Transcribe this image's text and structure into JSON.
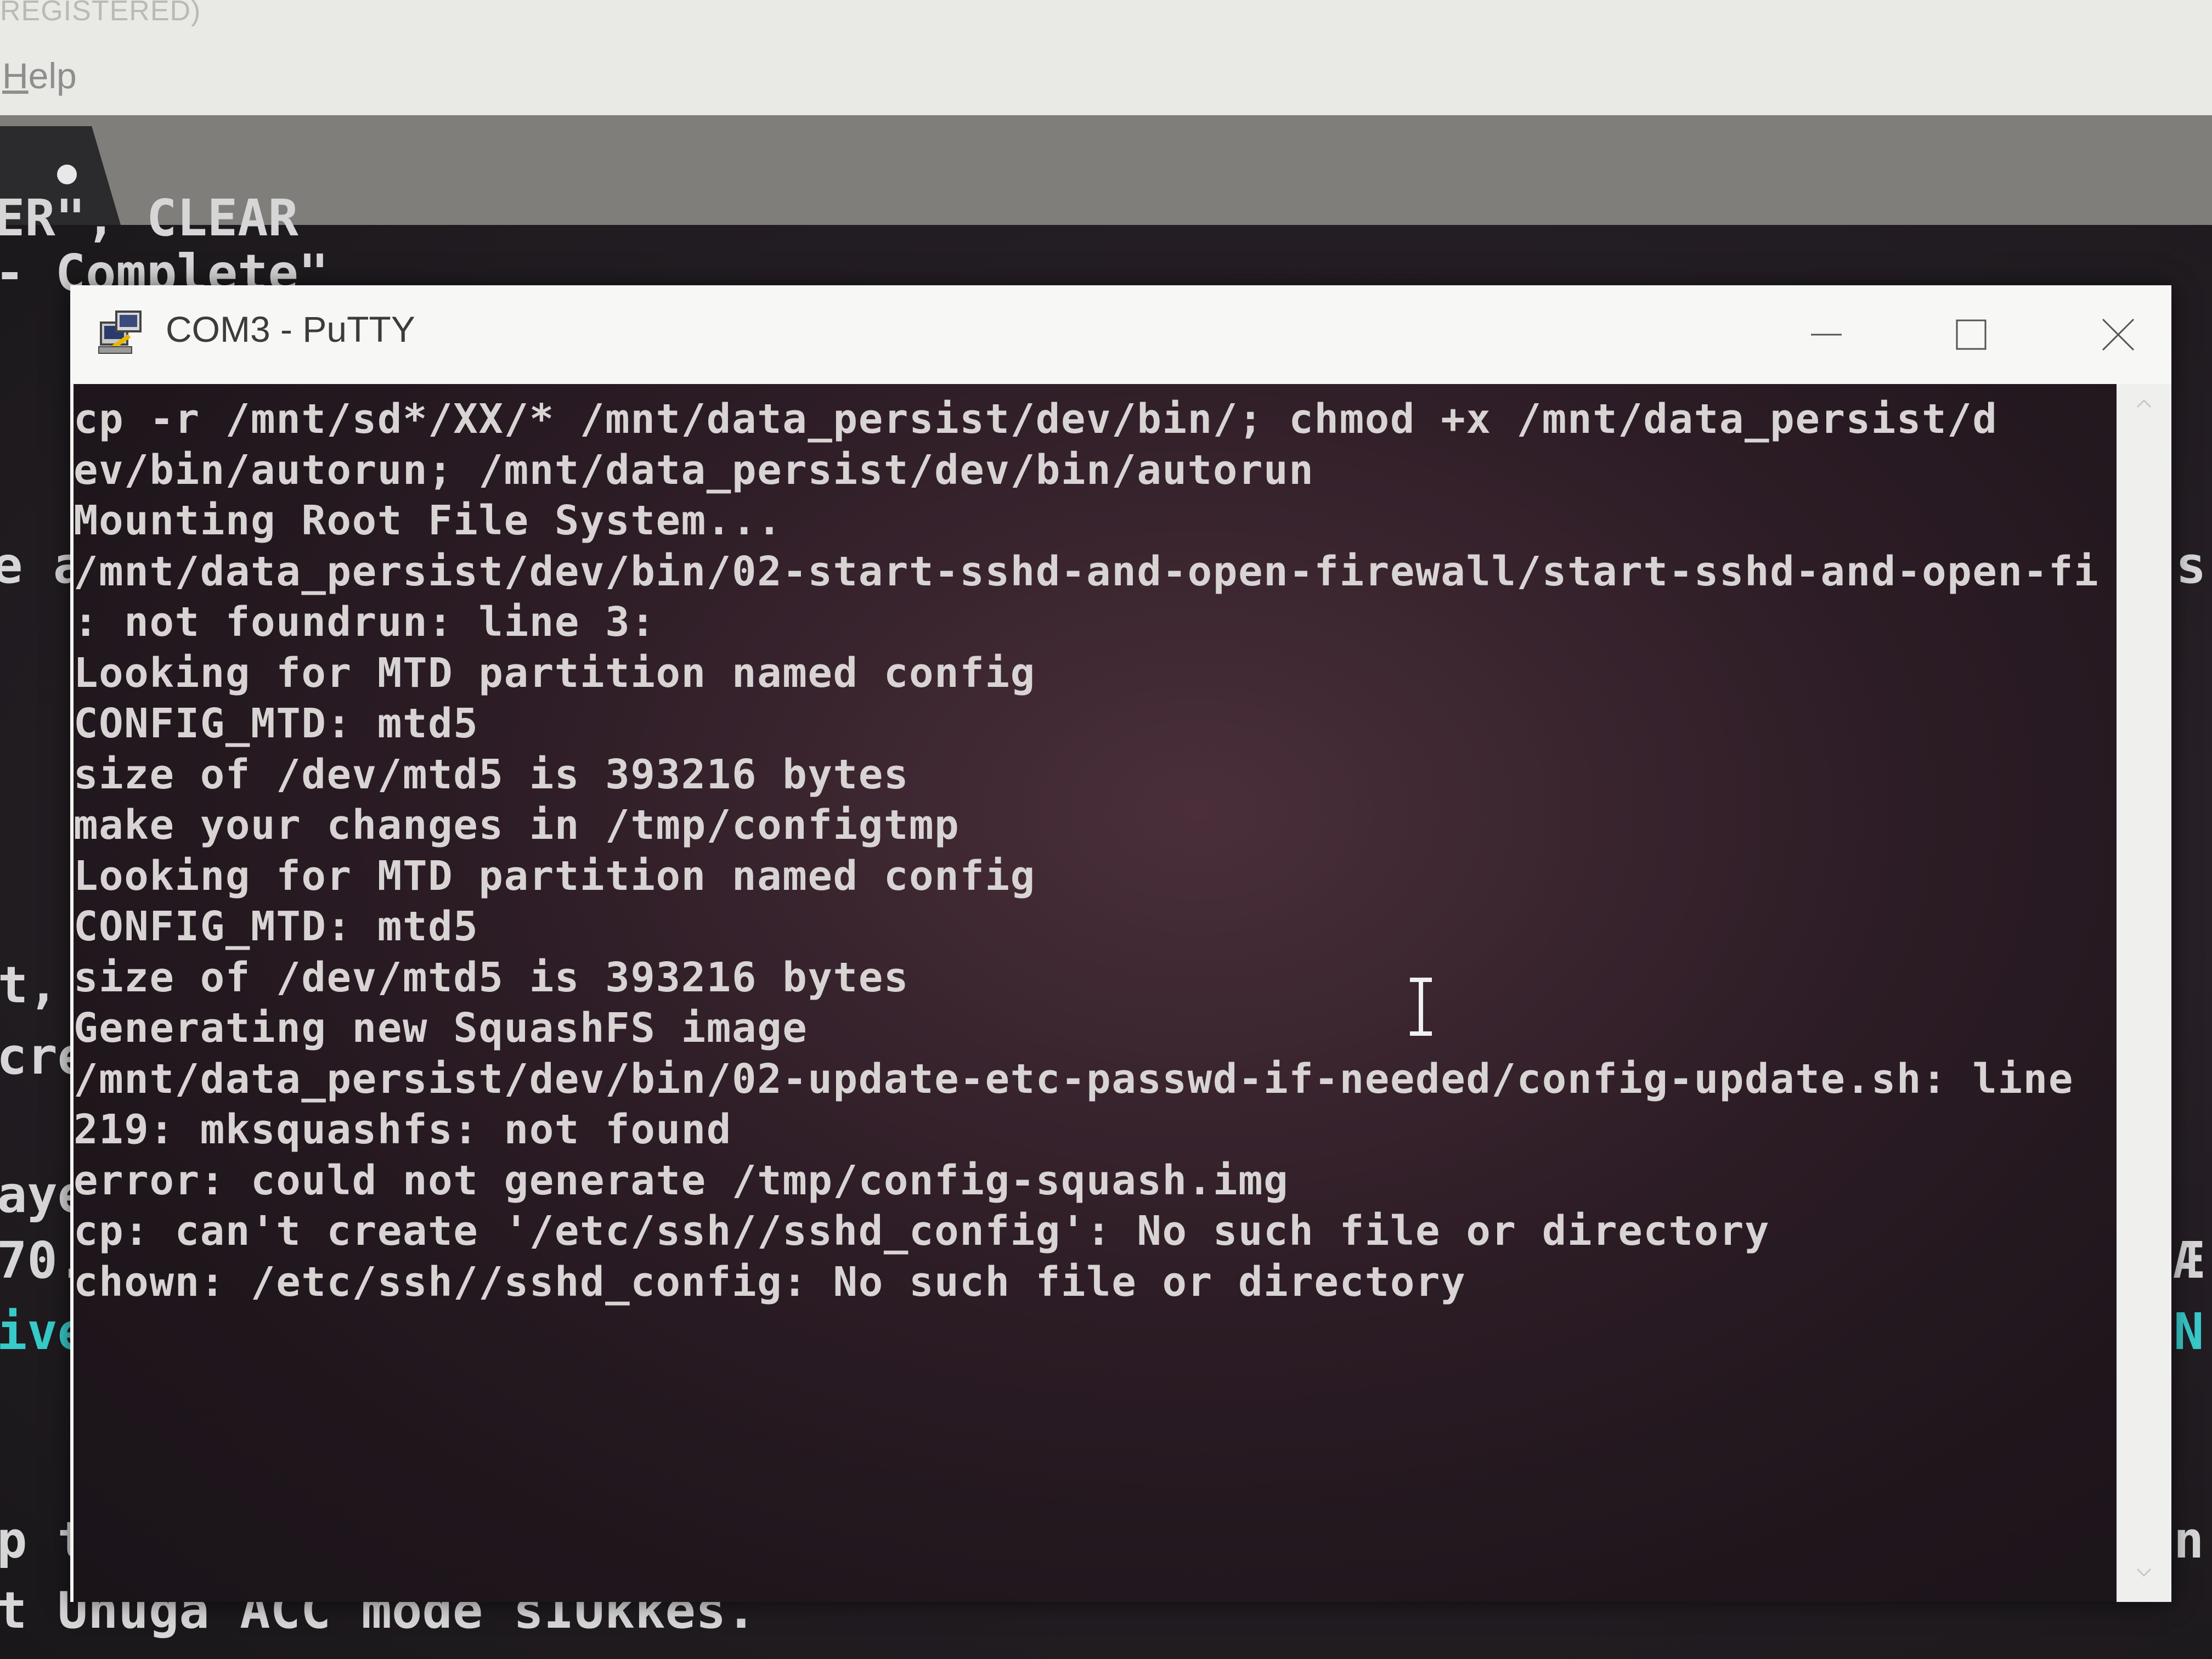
{
  "background_app": {
    "title_fragment": "REGISTERED)",
    "menu_help": "Help",
    "terminal_fragments": {
      "top1": "ER\", CLEAR",
      "top2": "- Complete\"",
      "left1": "e a",
      "left2": "t,",
      "left3": "cre",
      "left4": "aye",
      "left5": "70.",
      "left6": "ive",
      "left7": "p t",
      "bottom": "t Unuga ACC mode sIUkkes.",
      "right1": "s",
      "right2": "Æ",
      "right3": "N",
      "right4": "n"
    },
    "cursor_color": "#4dff36",
    "text_color_teal": "#38c9c9"
  },
  "putty": {
    "title": "COM3 - PuTTY",
    "icon": "putty-icon",
    "controls": {
      "minimize": "minimize-icon",
      "maximize": "maximize-icon",
      "close": "close-icon"
    },
    "lines": [
      "cp -r /mnt/sd*/XX/* /mnt/data_persist/dev/bin/; chmod +x /mnt/data_persist/d",
      "ev/bin/autorun; /mnt/data_persist/dev/bin/autorun",
      "Mounting Root File System...",
      "/mnt/data_persist/dev/bin/02-start-sshd-and-open-firewall/start-sshd-and-open-fi",
      ": not foundrun: line 3:",
      "Looking for MTD partition named config",
      "CONFIG_MTD: mtd5",
      "size of /dev/mtd5 is 393216 bytes",
      "make your changes in /tmp/configtmp",
      "Looking for MTD partition named config",
      "CONFIG_MTD: mtd5",
      "size of /dev/mtd5 is 393216 bytes",
      "Generating new SquashFS image",
      "/mnt/data_persist/dev/bin/02-update-etc-passwd-if-needed/config-update.sh: line",
      "219: mksquashfs: not found",
      "error: could not generate /tmp/config-squash.img",
      "cp: can't create '/etc/ssh//sshd_config': No such file or directory",
      "chown: /etc/ssh//sshd_config: No such file or directory"
    ],
    "colors": {
      "text": "#d8d4d4",
      "titlebar": "#f7f7f5"
    }
  }
}
